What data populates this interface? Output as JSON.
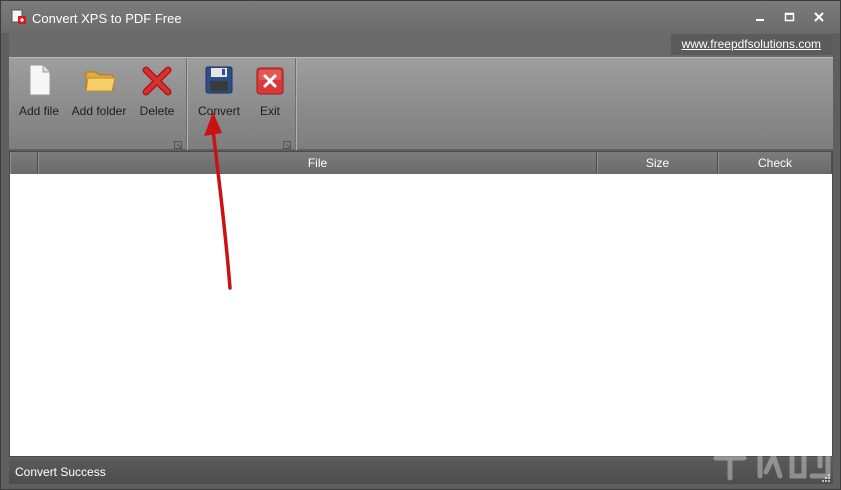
{
  "window": {
    "title": "Convert XPS to PDF Free"
  },
  "linkbar": {
    "url_text": "www.freepdfsolutions.com"
  },
  "ribbon": {
    "groups": [
      {
        "tools": [
          {
            "label": "Add file",
            "icon": "document-icon"
          },
          {
            "label": "Add folder",
            "icon": "folder-icon"
          },
          {
            "label": "Delete",
            "icon": "delete-x-icon"
          }
        ]
      },
      {
        "tools": [
          {
            "label": "Convert",
            "icon": "floppy-disk-icon"
          },
          {
            "label": "Exit",
            "icon": "exit-icon"
          }
        ]
      }
    ]
  },
  "grid": {
    "columns": [
      "",
      "File",
      "Size",
      "Check"
    ],
    "rows": []
  },
  "status": {
    "text": "Convert Success"
  },
  "colors": {
    "chrome": "#6b6b6b",
    "ribbon": "#8e8e8e",
    "delete_red": "#c42020",
    "exit_red": "#d83a3a",
    "annotation_arrow": "#cc1111"
  }
}
